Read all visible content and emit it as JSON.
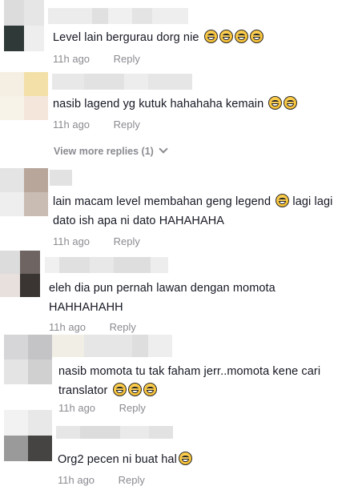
{
  "comments": [
    {
      "text": "Level lain bergurau dorg nie",
      "emoji_count": 4,
      "time": "11h ago",
      "reply": "Reply"
    },
    {
      "text": "nasib lagend yg kutuk hahahaha kemain",
      "emoji_count": 2,
      "time": "11h ago",
      "reply": "Reply"
    },
    {
      "text_line1": "lain macam level membahan geng legend",
      "line1_emoji_count": 1,
      "text_line1_tail": "lagi lagi",
      "text_line2": "dato ish apa ni dato HAHAHAHA",
      "time": "11h ago",
      "reply": "Reply"
    },
    {
      "text_line1": "eleh dia pun pernah lawan dengan momota",
      "text_line2": "HAHHAHAHH",
      "time": "11h ago",
      "reply": "Reply"
    },
    {
      "text_line1": "nasib momota tu tak faham jerr..momota kene cari",
      "text_line2": "translator",
      "emoji_count": 3,
      "time": "11h ago",
      "reply": "Reply"
    },
    {
      "text": "Org2 pecen ni buat hal",
      "emoji_count": 1,
      "time": "11h ago",
      "reply": "Reply"
    }
  ],
  "view_more": "View more replies (1)",
  "emoji_icon": "grinning-sweat-emoji",
  "colors": {
    "text": "#161823",
    "meta": "#8a8b91"
  }
}
